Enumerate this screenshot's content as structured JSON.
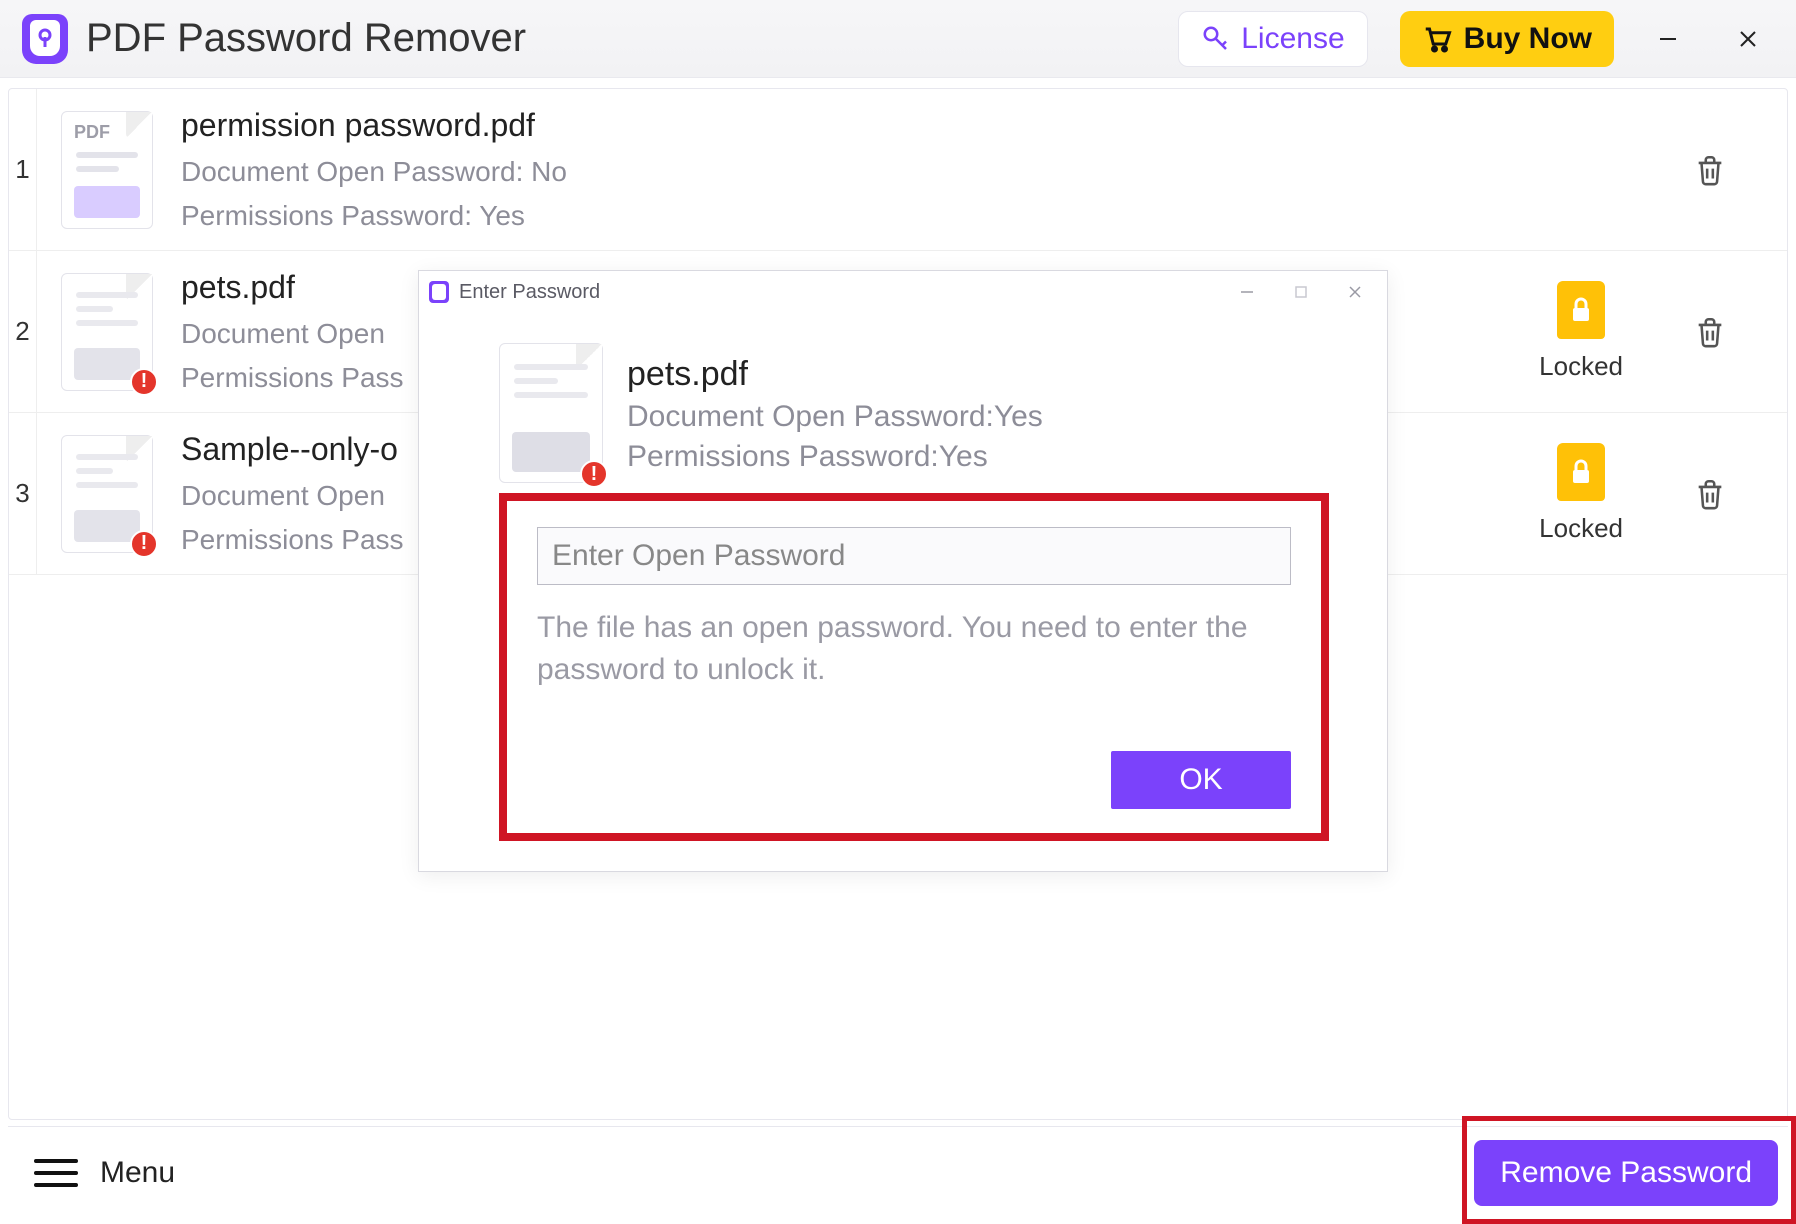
{
  "app": {
    "title": "PDF Password Remover"
  },
  "titlebar": {
    "license_label": "License",
    "buy_label": "Buy Now"
  },
  "files": [
    {
      "name": "permission password.pdf",
      "open_pw_line": "Document Open Password: No",
      "perm_pw_line": "Permissions Password: Yes",
      "locked": false,
      "alert": false,
      "pdf_label": "PDF"
    },
    {
      "name": "pets.pdf",
      "open_pw_line": "Document Open",
      "perm_pw_line": "Permissions Pass",
      "locked": true,
      "locked_label": "Locked",
      "alert": true
    },
    {
      "name": "Sample--only-o",
      "open_pw_line": "Document Open",
      "perm_pw_line": "Permissions Pass",
      "locked": true,
      "locked_label": "Locked",
      "alert": true
    }
  ],
  "footer": {
    "menu_label": "Menu",
    "remove_label": "Remove Password"
  },
  "dialog": {
    "title": "Enter Password",
    "file_name": "pets.pdf",
    "open_line": "Document Open Password:Yes",
    "perm_line": "Permissions Password:Yes",
    "input_placeholder": "Enter Open Password",
    "hint": "The file has an open password. You need to enter the password to unlock it.",
    "ok_label": "OK"
  },
  "row_index": [
    "1",
    "2",
    "3"
  ]
}
